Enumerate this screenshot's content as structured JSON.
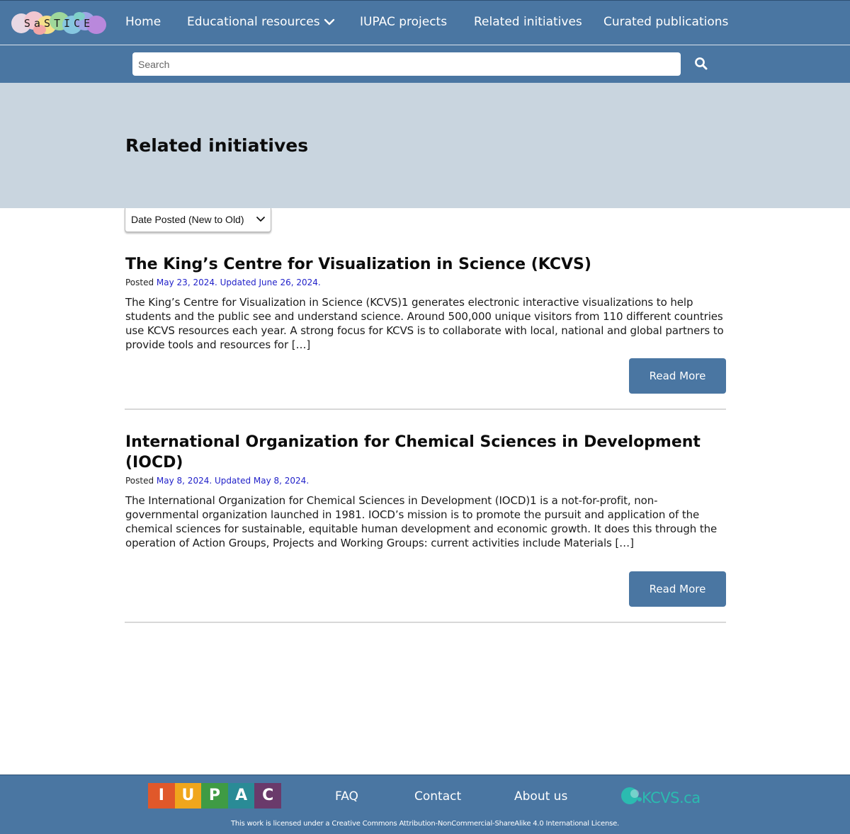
{
  "brand": {
    "logo_text": "SaSTICE",
    "colors": {
      "primary": "#4a76a2",
      "hero": "#c9d5df",
      "date_link": "#2121c9",
      "kcvs": "#2bbbb0"
    }
  },
  "nav": {
    "items": [
      {
        "label": "Home"
      },
      {
        "label": "Educational resources",
        "icon": "chevron-down-icon"
      },
      {
        "label": "IUPAC projects"
      },
      {
        "label": "Related initiatives"
      },
      {
        "label": "Curated publications"
      }
    ]
  },
  "search": {
    "placeholder": "Search",
    "value": "",
    "icon": "search-icon"
  },
  "page": {
    "title": "Related initiatives"
  },
  "sort": {
    "selected": "Date Posted (New to Old)",
    "icon": "chevron-down-icon"
  },
  "posts": [
    {
      "title": "The King’s Centre for Visualization in Science (KCVS)",
      "posted_prefix": "Posted ",
      "posted_date": "May 23, 2024",
      "updated_sep": ". Updated ",
      "updated_date": "June 26, 2024",
      "meta_end": ".",
      "excerpt": "The King’s Centre for Visualization in Science (KCVS)1 generates electronic interactive visualizations to help students and the public see and understand science. Around 500,000 unique visitors from 110 different countries use KCVS resources each year. A strong focus for KCVS is to collaborate with local, national and global partners to provide tools and resources for […]",
      "read_more": "Read More"
    },
    {
      "title": "International Organization for Chemical Sciences in Development (IOCD)",
      "posted_prefix": "Posted ",
      "posted_date": "May 8, 2024",
      "updated_sep": ". Updated ",
      "updated_date": "May 8, 2024",
      "meta_end": ".",
      "excerpt": "The International Organization for Chemical Sciences in Development (IOCD)1 is a not-for-profit, non-governmental organization launched in 1981. IOCD’s mission is to promote the pursuit and application of the chemical sciences for sustainable, equitable human development and economic growth. It does this through the operation of Action Groups, Projects and Working Groups: current activities include Materials […]",
      "read_more": "Read More"
    }
  ],
  "footer": {
    "iupac_letters": [
      "I",
      "U",
      "P",
      "A",
      "C"
    ],
    "iupac_colors": [
      "#e0582a",
      "#f0a61c",
      "#3f9b44",
      "#2a8b96",
      "#6a3a6b"
    ],
    "links": [
      {
        "label": "FAQ"
      },
      {
        "label": "Contact"
      },
      {
        "label": "About us"
      }
    ],
    "kcvs_text": "KCVS.ca",
    "license": "This work is licensed under a Creative Commons Attribution-NonCommercial-ShareAlike 4.0 International License."
  }
}
